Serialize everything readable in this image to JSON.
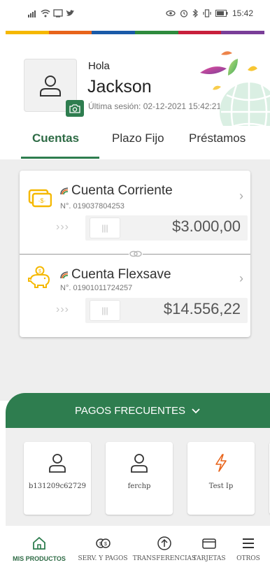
{
  "status_bar": {
    "time": "15:42",
    "left_icons": [
      "signal-icon",
      "wifi-icon",
      "cast-icon",
      "twitter-icon"
    ],
    "right_icons": [
      "eye-icon",
      "alarm-icon",
      "bluetooth-icon",
      "vibrate-icon",
      "battery-icon"
    ]
  },
  "brand_strip_colors": [
    "#f5b800",
    "#e8641b",
    "#1a5aa8",
    "#2e8b3d",
    "#c81f3c",
    "#7a3e98"
  ],
  "profile": {
    "greeting": "Hola",
    "name": "Jackson",
    "last_session": "Última sesión: 02-12-2021 15:42:21"
  },
  "tabs": [
    {
      "label": "Cuentas",
      "active": true
    },
    {
      "label": "Plazo Fijo",
      "active": false
    },
    {
      "label": "Préstamos",
      "active": false
    }
  ],
  "accounts": [
    {
      "name": "Cuenta Corriente",
      "number": "N°. 019037804253",
      "balance": "$3.000,00",
      "icon": "cash-icon"
    },
    {
      "name": "Cuenta Flexsave",
      "number": "N°. 01901011724257",
      "balance": "$14.556,22",
      "icon": "piggy-bank-icon"
    }
  ],
  "pagos": {
    "header": "PAGOS FRECUENTES",
    "items": [
      {
        "label": "b131209c62729",
        "icon": "user-icon"
      },
      {
        "label": "ferchp",
        "icon": "user-icon"
      },
      {
        "label": "Test Ip",
        "icon": "lightning-icon"
      }
    ]
  },
  "bottom_nav": [
    {
      "label": "MIS PRODUCTOS",
      "icon": "home-icon",
      "active": true
    },
    {
      "label": "SERV. Y PAGOS",
      "icon": "coins-icon",
      "active": false
    },
    {
      "label": "TRANSFERENCIAS",
      "icon": "transfer-icon",
      "active": false
    },
    {
      "label": "TARJETAS",
      "icon": "card-icon",
      "active": false
    },
    {
      "label": "OTROS",
      "icon": "menu-icon",
      "active": false
    }
  ],
  "colors": {
    "primary_green": "#2e7d4f",
    "lightning_orange": "#e8641b"
  }
}
